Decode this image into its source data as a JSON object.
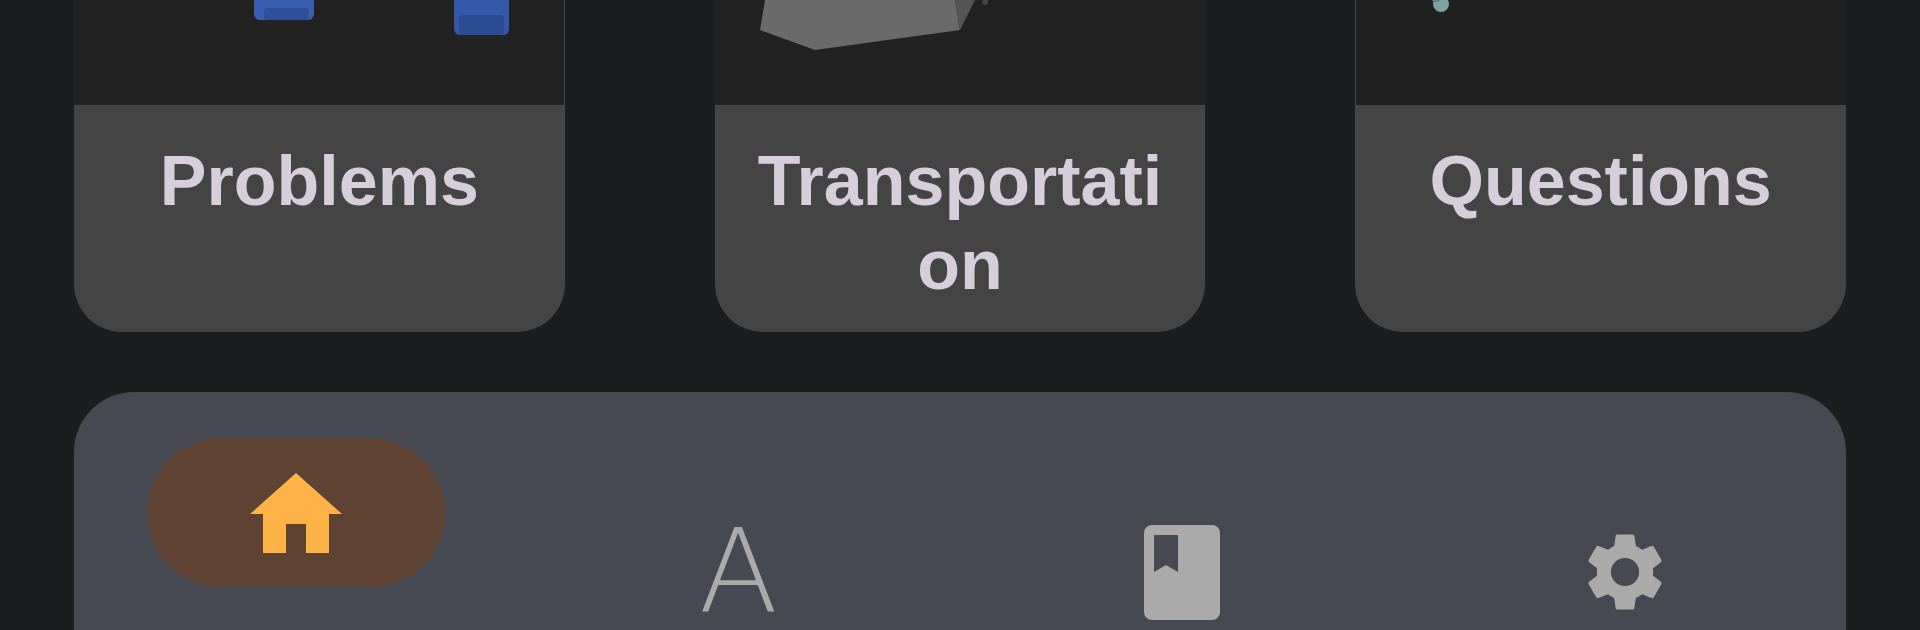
{
  "cards": [
    {
      "label": "Problems"
    },
    {
      "label": "Transportation"
    },
    {
      "label": "Questions"
    }
  ],
  "bottom_nav": {
    "items": [
      {
        "kind": "home",
        "selected": true
      },
      {
        "kind": "letter",
        "glyph": "A",
        "selected": false
      },
      {
        "kind": "book",
        "selected": false
      },
      {
        "kind": "settings",
        "selected": false
      }
    ]
  }
}
